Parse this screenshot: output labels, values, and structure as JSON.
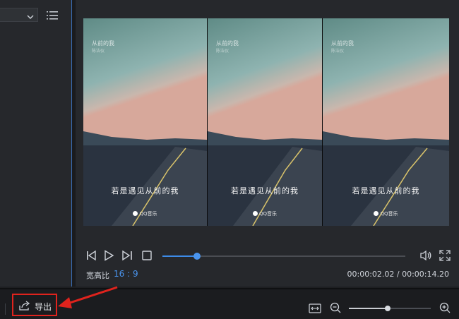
{
  "media_panel": {
    "dropdown_icon": "chevron-down-icon",
    "list_view_icon": "list-icon"
  },
  "preview": {
    "tiles": [
      {
        "song_title": "从前的我",
        "artist": "陈洁仪",
        "lyric": "若是遇见从前的我",
        "watermark": "QQ音乐"
      },
      {
        "song_title": "从前的我",
        "artist": "陈洁仪",
        "lyric": "若是遇见从前的我",
        "watermark": "QQ音乐"
      },
      {
        "song_title": "从前的我",
        "artist": "陈洁仪",
        "lyric": "若是遇见从前的我",
        "watermark": "QQ音乐"
      }
    ],
    "playback": {
      "progress_fraction": 0.142,
      "icons": [
        "skip-back-icon",
        "play-icon",
        "skip-forward-icon",
        "stop-icon",
        "volume-icon",
        "fullscreen-icon"
      ]
    },
    "aspect_ratio_label": "宽高比",
    "aspect_ratio_value": "16 : 9",
    "timecode": "00:00:02.02 / 00:00:14.20"
  },
  "toolbar": {
    "export_label": "导出",
    "export_icon": "export-share-icon",
    "zoom_fraction": 0.47,
    "icons": [
      "fit-width-icon",
      "zoom-out-icon",
      "zoom-in-icon"
    ]
  },
  "colors": {
    "accent": "#3d8be8",
    "highlight": "#e0231d"
  }
}
